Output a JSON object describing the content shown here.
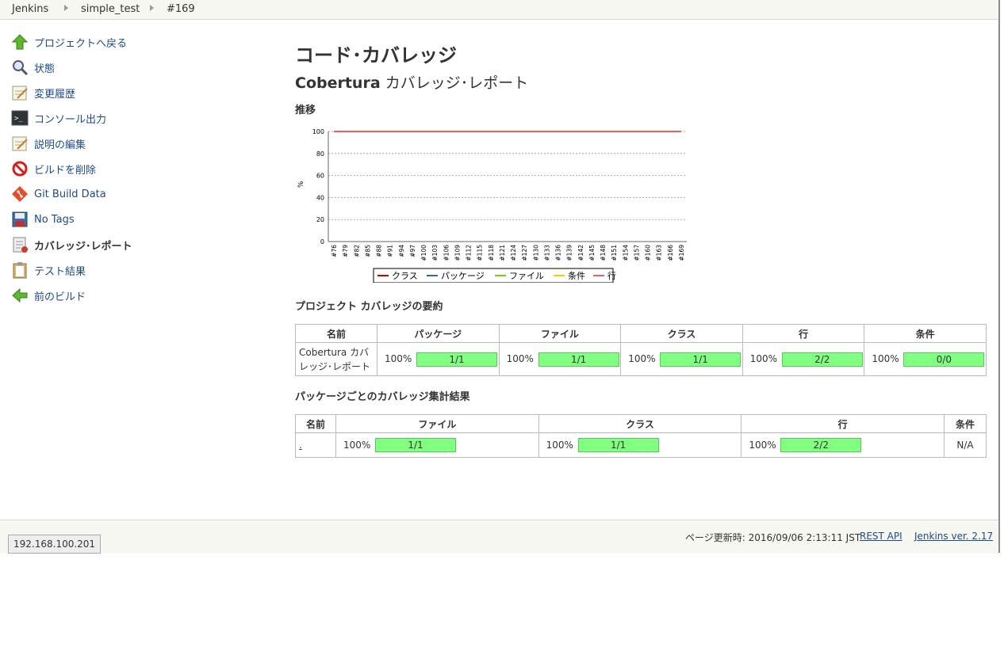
{
  "breadcrumb": [
    "Jenkins",
    "simple_test",
    "#169"
  ],
  "sidebar": {
    "items": [
      {
        "label": "プロジェクトへ戻る",
        "icon": "up-arrow-icon"
      },
      {
        "label": "状態",
        "icon": "magnifier-icon"
      },
      {
        "label": "変更履歴",
        "icon": "notepad-icon"
      },
      {
        "label": "コンソール出力",
        "icon": "terminal-icon"
      },
      {
        "label": "説明の編集",
        "icon": "notepad-edit-icon"
      },
      {
        "label": "ビルドを削除",
        "icon": "no-entry-icon"
      },
      {
        "label": "Git Build Data",
        "icon": "git-icon"
      },
      {
        "label": "No Tags",
        "icon": "floppy-icon"
      },
      {
        "label": "カバレッジ･レポート",
        "icon": "report-icon"
      },
      {
        "label": "テスト結果",
        "icon": "clipboard-icon"
      },
      {
        "label": "前のビルド",
        "icon": "left-arrow-icon"
      }
    ]
  },
  "main": {
    "title": "コード･カバレッジ",
    "subtitle_bold": "Cobertura",
    "subtitle_rest": " カバレッジ･レポート",
    "trend_heading": "推移",
    "summary_heading": "プロジェクト カバレッジの要約",
    "package_heading": "パッケージごとのカバレッジ集計結果"
  },
  "chart_data": {
    "type": "line",
    "ylabel": "%",
    "ylim": [
      0,
      100
    ],
    "yticks": [
      "0",
      "20",
      "40",
      "60",
      "80",
      "100"
    ],
    "categories": [
      "#76",
      "#79",
      "#82",
      "#85",
      "#88",
      "#91",
      "#94",
      "#97",
      "#100",
      "#103",
      "#106",
      "#109",
      "#112",
      "#115",
      "#118",
      "#121",
      "#124",
      "#127",
      "#130",
      "#133",
      "#136",
      "#139",
      "#142",
      "#145",
      "#148",
      "#151",
      "#154",
      "#157",
      "#160",
      "#163",
      "#166",
      "#169"
    ],
    "series": [
      {
        "name": "クラス",
        "color": "#cc0000",
        "value": 100
      },
      {
        "name": "パッケージ",
        "color": "#3465a4",
        "value": 100
      },
      {
        "name": "ファイル",
        "color": "#73d216",
        "value": 100
      },
      {
        "name": "条件",
        "color": "#edd400",
        "value": 100
      },
      {
        "name": "行",
        "color": "#ef5f5f",
        "value": 100
      }
    ],
    "grid": true,
    "legend": "bottom"
  },
  "summary_table": {
    "headers": [
      "名前",
      "パッケージ",
      "ファイル",
      "クラス",
      "行",
      "条件"
    ],
    "row": {
      "name": "Cobertura カバレッジ･レポート",
      "cells": [
        {
          "pct": "100%",
          "ratio": "1/1"
        },
        {
          "pct": "100%",
          "ratio": "1/1"
        },
        {
          "pct": "100%",
          "ratio": "1/1"
        },
        {
          "pct": "100%",
          "ratio": "2/2"
        },
        {
          "pct": "100%",
          "ratio": "0/0"
        }
      ]
    }
  },
  "package_table": {
    "headers": [
      "名前",
      "ファイル",
      "クラス",
      "行",
      "条件"
    ],
    "row": {
      "name": ".",
      "cells": [
        {
          "pct": "100%",
          "ratio": "1/1"
        },
        {
          "pct": "100%",
          "ratio": "1/1"
        },
        {
          "pct": "100%",
          "ratio": "2/2"
        }
      ],
      "condition": "N/A"
    }
  },
  "footer": {
    "updated": "ページ更新時: 2016/09/06 2:13:11 JST",
    "rest_api": "REST API",
    "version": "Jenkins ver. 2.17",
    "ip": "192.168.100.201"
  }
}
